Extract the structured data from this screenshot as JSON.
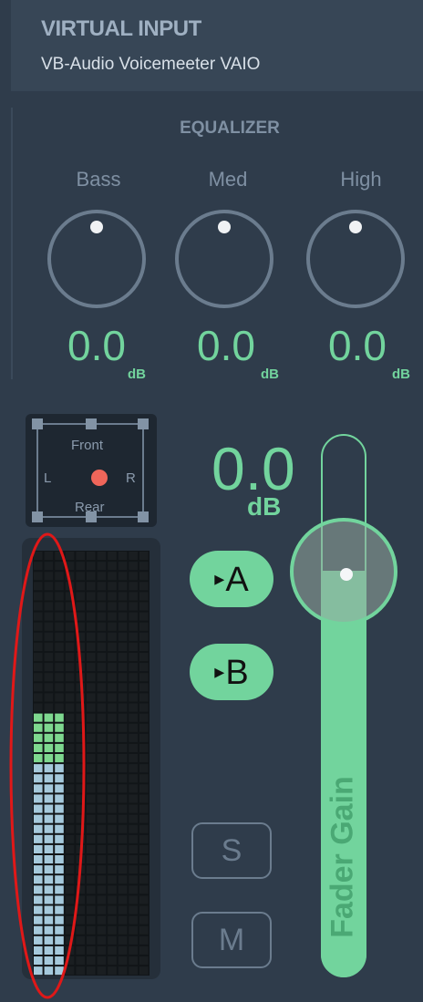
{
  "header": {
    "title": "VIRTUAL INPUT",
    "subtitle": "VB-Audio Voicemeeter VAIO"
  },
  "equalizer": {
    "title": "EQUALIZER",
    "bands": [
      {
        "label": "Bass",
        "value": "0.0",
        "unit": "dB"
      },
      {
        "label": "Med",
        "value": "0.0",
        "unit": "dB"
      },
      {
        "label": "High",
        "value": "0.0",
        "unit": "dB"
      }
    ]
  },
  "pan": {
    "front": "Front",
    "rear": "Rear",
    "left": "L",
    "right": "R"
  },
  "gain": {
    "value": "0.0",
    "unit": "dB",
    "fader_label": "Fader Gain"
  },
  "routing": {
    "a_label": "A",
    "b_label": "B",
    "arrow": "▸"
  },
  "controls": {
    "solo_label": "S",
    "mute_label": "M"
  },
  "meter": {
    "level_fraction": 0.63,
    "green_fraction_start": 0.5,
    "colors": {
      "lit_low": "#a5c9dc",
      "lit_high": "#7ed88f",
      "unlit": "#1a1e21"
    }
  },
  "colors": {
    "accent": "#72d49d",
    "annotation": "#e01818"
  }
}
